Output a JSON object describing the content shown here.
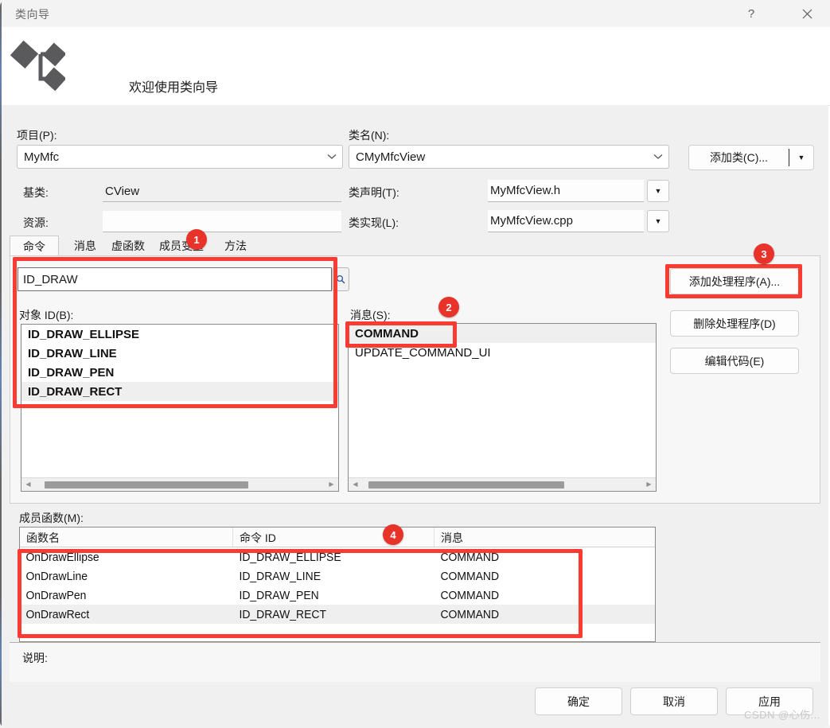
{
  "window": {
    "title": "类向导",
    "help_icon": "question-mark-icon",
    "close_icon": "close-icon"
  },
  "banner": {
    "icon": "class-hierarchy-icon",
    "title": "欢迎使用类向导"
  },
  "form": {
    "project_label": "项目(P):",
    "project_value": "MyMfc",
    "base_class_label": "基类:",
    "base_class_value": "CView",
    "resource_label": "资源:",
    "resource_value": "",
    "class_name_label": "类名(N):",
    "class_name_value": "CMyMfcView",
    "class_decl_label": "类声明(T):",
    "class_decl_value": "MyMfcView.h",
    "class_impl_label": "类实现(L):",
    "class_impl_value": "MyMfcView.cpp",
    "add_class_label": "添加类(C)...",
    "add_class_arrow": "chevron-down-icon"
  },
  "tabs": [
    {
      "label": "命令",
      "active": true
    },
    {
      "label": "消息",
      "active": false
    },
    {
      "label": "虚函数",
      "active": false
    },
    {
      "label": "成员变量",
      "active": false
    },
    {
      "label": "方法",
      "active": false
    }
  ],
  "search": {
    "value": "ID_DRAW",
    "button_icon": "search-icon"
  },
  "object_ids": {
    "label": "对象 ID(B):",
    "items": [
      {
        "text": "ID_DRAW_ELLIPSE",
        "bold": true,
        "selected": false
      },
      {
        "text": "ID_DRAW_LINE",
        "bold": true,
        "selected": false
      },
      {
        "text": "ID_DRAW_PEN",
        "bold": true,
        "selected": false
      },
      {
        "text": "ID_DRAW_RECT",
        "bold": true,
        "selected": true
      }
    ]
  },
  "messages": {
    "label": "消息(S):",
    "items": [
      {
        "text": "COMMAND",
        "bold": true,
        "selected": true
      },
      {
        "text": "UPDATE_COMMAND_UI",
        "bold": false,
        "selected": false
      }
    ]
  },
  "side_buttons": [
    {
      "label": "添加处理程序(A)..."
    },
    {
      "label": "删除处理程序(D)"
    },
    {
      "label": "编辑代码(E)"
    }
  ],
  "member_functions": {
    "label": "成员函数(M):",
    "columns": [
      "函数名",
      "命令 ID",
      "消息"
    ],
    "rows": [
      {
        "cells": [
          "OnDrawEllipse",
          "ID_DRAW_ELLIPSE",
          "COMMAND"
        ],
        "selected": false
      },
      {
        "cells": [
          "OnDrawLine",
          "ID_DRAW_LINE",
          "COMMAND"
        ],
        "selected": false
      },
      {
        "cells": [
          "OnDrawPen",
          "ID_DRAW_PEN",
          "COMMAND"
        ],
        "selected": false
      },
      {
        "cells": [
          "OnDrawRect",
          "ID_DRAW_RECT",
          "COMMAND"
        ],
        "selected": true
      }
    ]
  },
  "description": {
    "label": "说明:",
    "value": ""
  },
  "footer": {
    "ok": "确定",
    "cancel": "取消",
    "apply": "应用"
  },
  "annotations": [
    {
      "number": "1"
    },
    {
      "number": "2"
    },
    {
      "number": "3"
    },
    {
      "number": "4"
    }
  ],
  "watermark": "CSDN @心伤...",
  "colors": {
    "annotation_red": "#f93b34",
    "badge_red": "#e8332a",
    "panel_bg": "#f0f0f0",
    "title_bar_bg": "#f3f3f3"
  }
}
